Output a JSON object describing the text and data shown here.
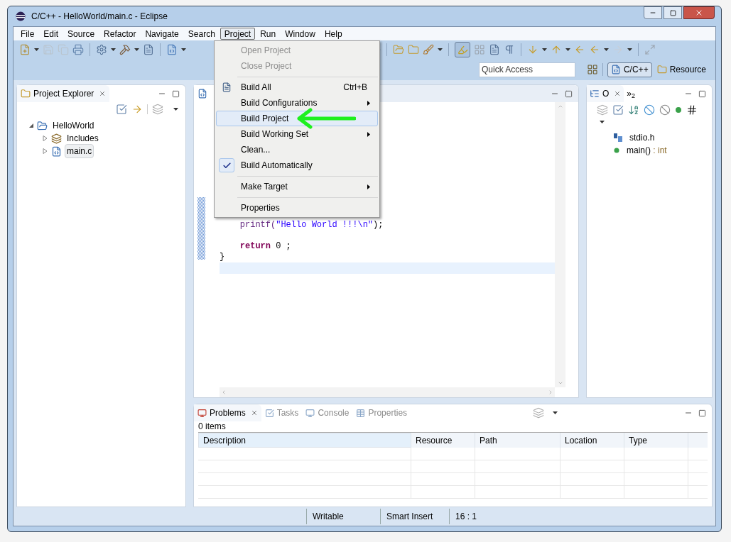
{
  "window": {
    "title": "C/C++ - HelloWorld/main.c - Eclipse"
  },
  "menu_bar": [
    {
      "label": "File",
      "selected": false
    },
    {
      "label": "Edit",
      "selected": false
    },
    {
      "label": "Source",
      "selected": false
    },
    {
      "label": "Refactor",
      "selected": false
    },
    {
      "label": "Navigate",
      "selected": false
    },
    {
      "label": "Search",
      "selected": false
    },
    {
      "label": "Project",
      "selected": true
    },
    {
      "label": "Run",
      "selected": false
    },
    {
      "label": "Window",
      "selected": false
    },
    {
      "label": "Help",
      "selected": false
    }
  ],
  "project_menu": [
    {
      "kind": "item",
      "label": "Open Project",
      "disabled": true,
      "selected": false,
      "checked": false,
      "submenu": false
    },
    {
      "kind": "item",
      "label": "Close Project",
      "disabled": true,
      "selected": false,
      "checked": false,
      "submenu": false
    },
    {
      "kind": "separator"
    },
    {
      "kind": "item",
      "label": "Build All",
      "shortcut": "Ctrl+B",
      "disabled": false,
      "selected": false,
      "checked": false,
      "submenu": false
    },
    {
      "kind": "item",
      "label": "Build Configurations",
      "disabled": false,
      "selected": false,
      "checked": false,
      "submenu": true
    },
    {
      "kind": "item",
      "label": "Build Project",
      "disabled": false,
      "selected": true,
      "checked": false,
      "submenu": false
    },
    {
      "kind": "item",
      "label": "Build Working Set",
      "disabled": false,
      "selected": false,
      "checked": false,
      "submenu": true
    },
    {
      "kind": "item",
      "label": "Clean...",
      "disabled": false,
      "selected": false,
      "checked": false,
      "submenu": false
    },
    {
      "kind": "item",
      "label": "Build Automatically",
      "disabled": false,
      "selected": false,
      "checked": true,
      "submenu": false
    },
    {
      "kind": "separator"
    },
    {
      "kind": "item",
      "label": "Make Target",
      "disabled": false,
      "selected": false,
      "checked": false,
      "submenu": true
    },
    {
      "kind": "separator"
    },
    {
      "kind": "item",
      "label": "Properties",
      "disabled": false,
      "selected": false,
      "checked": false,
      "submenu": false
    }
  ],
  "quick_access": {
    "placeholder": "Quick Access"
  },
  "perspectives": [
    {
      "label": "C/C++",
      "selected": true
    },
    {
      "label": "Resource",
      "selected": false
    }
  ],
  "project_explorer": {
    "title": "Project Explorer",
    "tree": [
      {
        "label": "HelloWorld",
        "kind": "project",
        "expanded": true,
        "selected": false,
        "children": [
          {
            "label": "Includes",
            "kind": "includes",
            "expanded": false,
            "selected": false
          },
          {
            "label": "main.c",
            "kind": "source",
            "expanded": false,
            "selected": true
          }
        ]
      }
    ]
  },
  "editor": {
    "lines": [
      {
        "kind": "code",
        "current": false,
        "tokens": [
          {
            "kind": "function",
            "text": "    printf("
          },
          {
            "kind": "string",
            "text": "\"Hello World !!!\\n\""
          },
          {
            "kind": "plain",
            "text": ");"
          }
        ]
      },
      {
        "kind": "blank",
        "current": false
      },
      {
        "kind": "code",
        "current": false,
        "tokens": [
          {
            "kind": "keyword",
            "text": "    return"
          },
          {
            "kind": "plain",
            "text": " 0 ;"
          }
        ]
      },
      {
        "kind": "code",
        "current": false,
        "tokens": [
          {
            "kind": "plain",
            "text": "}"
          }
        ]
      },
      {
        "kind": "blank",
        "current": true
      }
    ]
  },
  "outline": {
    "tabs": [
      {
        "label": "O",
        "selected": true
      },
      {
        "label": "»$_{2}$",
        "selected": false
      }
    ],
    "items": [
      {
        "kind": "include",
        "label": "stdio.h"
      },
      {
        "kind": "function",
        "label": "main()",
        "type": ": int"
      }
    ]
  },
  "problems": {
    "tabs": [
      {
        "label": "Problems",
        "selected": true
      },
      {
        "label": "Tasks",
        "selected": false
      },
      {
        "label": "Console",
        "selected": false
      },
      {
        "label": "Properties",
        "selected": false
      }
    ],
    "count": "0 items",
    "columns": [
      "Description",
      "Resource",
      "Path",
      "Location",
      "Type"
    ]
  },
  "status_bar": [
    "Writable",
    "Smart Insert",
    "16 : 1"
  ]
}
